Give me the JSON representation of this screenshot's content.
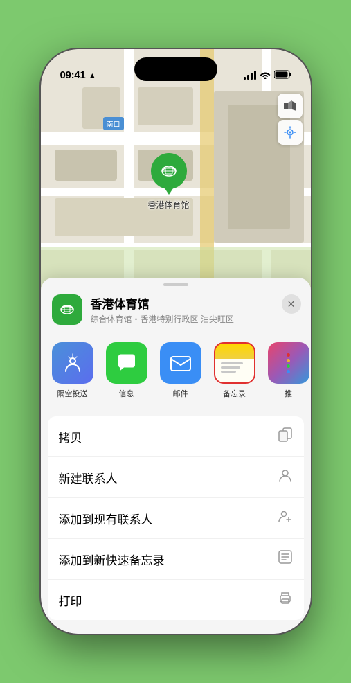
{
  "statusBar": {
    "time": "09:41",
    "locationIcon": "▲"
  },
  "map": {
    "labelNankou": "南口",
    "stadiumName": "香港体育馆",
    "controls": {
      "mapTypeIcon": "🗺",
      "locationIcon": "➤"
    }
  },
  "venueCard": {
    "name": "香港体育馆",
    "subtitle": "综合体育馆・香港特别行政区 油尖旺区",
    "closeLabel": "✕"
  },
  "shareItems": [
    {
      "id": "airdrop",
      "label": "隔空投送",
      "type": "airdrop"
    },
    {
      "id": "message",
      "label": "信息",
      "type": "message"
    },
    {
      "id": "mail",
      "label": "邮件",
      "type": "mail"
    },
    {
      "id": "notes",
      "label": "备忘录",
      "type": "notes",
      "selected": true
    },
    {
      "id": "more",
      "label": "推",
      "type": "more"
    }
  ],
  "actions": [
    {
      "id": "copy",
      "label": "拷贝",
      "icon": "copy"
    },
    {
      "id": "new-contact",
      "label": "新建联系人",
      "icon": "person"
    },
    {
      "id": "add-existing",
      "label": "添加到现有联系人",
      "icon": "person-add"
    },
    {
      "id": "quick-note",
      "label": "添加到新快速备忘录",
      "icon": "note"
    },
    {
      "id": "print",
      "label": "打印",
      "icon": "print"
    }
  ]
}
